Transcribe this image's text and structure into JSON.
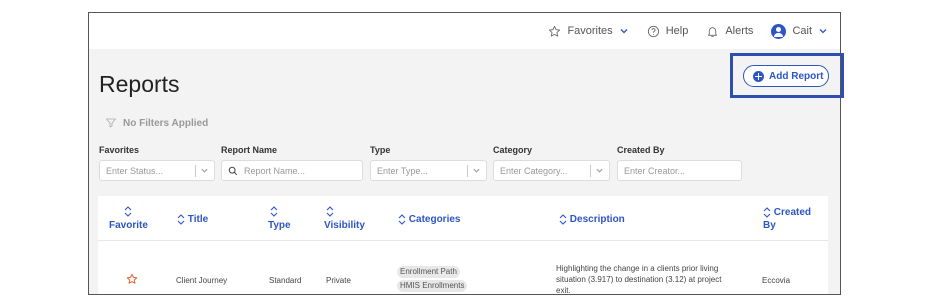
{
  "topbar": {
    "favorites": "Favorites",
    "help": "Help",
    "alerts": "Alerts",
    "user": "Cait"
  },
  "page": {
    "title": "Reports",
    "add_button": "Add Report",
    "no_filters": "No Filters Applied"
  },
  "filters": [
    {
      "label": "Favorites",
      "placeholder": "Enter Status..."
    },
    {
      "label": "Report Name",
      "placeholder": "Report Name..."
    },
    {
      "label": "Type",
      "placeholder": "Enter Type..."
    },
    {
      "label": "Category",
      "placeholder": "Enter Category..."
    },
    {
      "label": "Created By",
      "placeholder": "Enter Creator..."
    }
  ],
  "table": {
    "headers": {
      "favorite": "Favorite",
      "title": "Title",
      "type": "Type",
      "visibility": "Visibility",
      "categories": "Categories",
      "description": "Description",
      "created_by": "Created By"
    },
    "rows": [
      {
        "title": "Client Journey",
        "type": "Standard",
        "visibility": "Private",
        "categories": [
          "Enrollment Path",
          "HMIS Enrollments"
        ],
        "description_lines": [
          "Highlighting the change in a clients prior living",
          "situation (3.917) to destination (3.12) at project",
          "exit."
        ],
        "created_by": "Eccovia"
      }
    ]
  },
  "colors": {
    "accent": "#2d56c4",
    "highlight_box": "#2c4fb0",
    "star": "#e8622c",
    "page_bg": "#f3f3f3"
  }
}
